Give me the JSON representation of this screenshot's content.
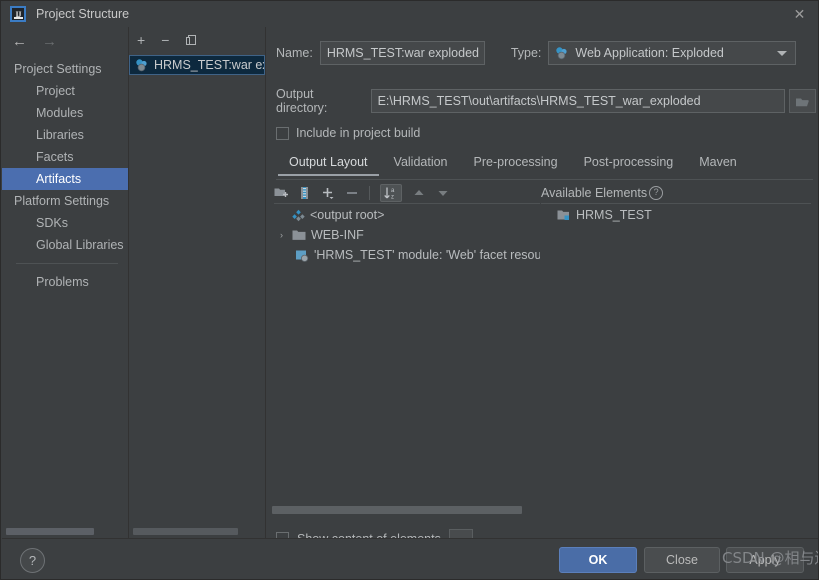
{
  "window": {
    "title": "Project Structure",
    "app_icon": "intellij-idea-icon",
    "close_label": "✕"
  },
  "nav": {
    "back": "←",
    "forward": "→"
  },
  "sidebar": {
    "groups": [
      {
        "label": "Project Settings",
        "items": [
          {
            "label": "Project",
            "selected": false
          },
          {
            "label": "Modules",
            "selected": false
          },
          {
            "label": "Libraries",
            "selected": false
          },
          {
            "label": "Facets",
            "selected": false
          },
          {
            "label": "Artifacts",
            "selected": true
          }
        ]
      },
      {
        "label": "Platform Settings",
        "items": [
          {
            "label": "SDKs",
            "selected": false
          },
          {
            "label": "Global Libraries",
            "selected": false
          }
        ]
      }
    ],
    "problems": "Problems"
  },
  "artifacts_panel": {
    "toolbar": [
      {
        "name": "add-artifact-button",
        "glyph": "+"
      },
      {
        "name": "remove-artifact-button",
        "glyph": "−"
      },
      {
        "name": "copy-artifact-button",
        "glyph": "⧉"
      }
    ],
    "items": [
      {
        "label": "HRMS_TEST:war exploded",
        "icon": "artifact-icon",
        "selected": true
      }
    ]
  },
  "form": {
    "name_label": "Name:",
    "name_value": "HRMS_TEST:war exploded",
    "type_label": "Type:",
    "type_value": "Web Application: Exploded",
    "type_icon": "artifact-icon",
    "output_label": "Output directory:",
    "output_value": "E:\\HRMS_TEST\\out\\artifacts\\HRMS_TEST_war_exploded",
    "browse_icon": "folder-open-icon",
    "include_label": "Include in project build",
    "include_checked": false
  },
  "tabs": [
    {
      "label": "Output Layout",
      "active": true
    },
    {
      "label": "Validation",
      "active": false
    },
    {
      "label": "Pre-processing",
      "active": false
    },
    {
      "label": "Post-processing",
      "active": false
    },
    {
      "label": "Maven",
      "active": false
    }
  ],
  "content_toolbar": [
    {
      "name": "create-directory-icon"
    },
    {
      "name": "create-archive-icon"
    },
    {
      "name": "add-element-icon"
    },
    {
      "name": "remove-element-icon"
    },
    {
      "name": "separator"
    },
    {
      "name": "sort-alphabetically-icon",
      "toggled": true
    },
    {
      "name": "move-up-icon"
    },
    {
      "name": "move-down-icon"
    }
  ],
  "output_layout_tree": [
    {
      "label": "<output root>",
      "icon": "artifact-root-icon",
      "indent": 0,
      "twisty": ""
    },
    {
      "label": "WEB-INF",
      "icon": "folder-icon",
      "indent": 0,
      "twisty": "›"
    },
    {
      "label": "'HRMS_TEST' module: 'Web' facet resou",
      "icon": "facet-resource-icon",
      "indent": 1,
      "twisty": ""
    }
  ],
  "available_elements": {
    "title": "Available Elements",
    "help_glyph": "?",
    "items": [
      {
        "label": "HRMS_TEST",
        "icon": "module-icon"
      }
    ]
  },
  "show_content": {
    "label": "Show content of elements",
    "checked": false,
    "more_button": "..."
  },
  "footer": {
    "help_glyph": "?",
    "ok": "OK",
    "close": "Close",
    "apply": "Apply"
  },
  "watermark": "CSDN @相与还",
  "colors": {
    "background": "#3c3f41",
    "selection_blue": "#4b6eaf",
    "list_selection": "#0d293e",
    "accent_button": "#4a6da7",
    "text": "#bbbbbb",
    "icon_cyan": "#3592c4"
  }
}
